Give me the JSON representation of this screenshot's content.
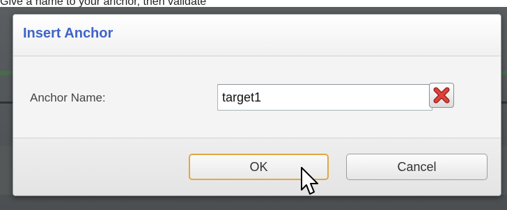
{
  "caption": "Give a name to your anchor, then validate",
  "dialog": {
    "title": "Insert Anchor",
    "field_label": "Anchor Name:",
    "anchor_name_value": "target1",
    "ok_label": "OK",
    "cancel_label": "Cancel"
  },
  "icons": {
    "clear": "close-x-icon",
    "cursor": "mouse-pointer-icon"
  },
  "colors": {
    "title": "#3f64c8",
    "ok_border": "#e2a640",
    "clear_x": "#d6302a"
  }
}
